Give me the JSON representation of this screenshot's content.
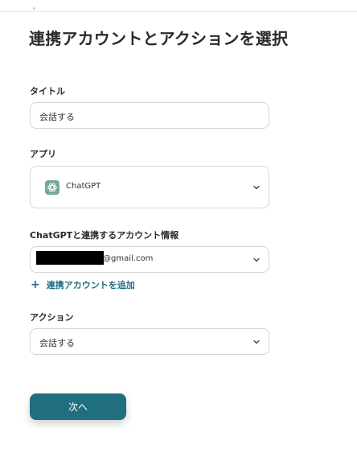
{
  "header": {
    "title": "連携アカウントとアクションを選択"
  },
  "form": {
    "title_field": {
      "label": "タイトル",
      "value": "会話する"
    },
    "app_field": {
      "label": "アプリ",
      "value": "ChatGPT",
      "icon": "chatgpt-logo-icon"
    },
    "account_field": {
      "label": "ChatGPTと連携するアカウント情報",
      "value_suffix": "@gmail.com",
      "redacted": true
    },
    "add_account_link": {
      "label": "連携アカウントを追加",
      "icon": "plus-icon"
    },
    "action_field": {
      "label": "アクション",
      "value": "会話する"
    }
  },
  "footer": {
    "next_label": "次へ"
  },
  "colors": {
    "accent": "#1f6f80",
    "border": "#d4d4d4",
    "chatgpt_icon_bg": "#74aa9c"
  }
}
